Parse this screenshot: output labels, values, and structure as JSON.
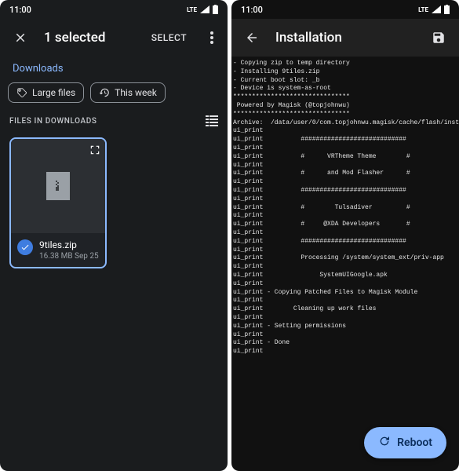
{
  "status": {
    "time": "11:00",
    "network": "LTE"
  },
  "left": {
    "title": "1 selected",
    "select": "SELECT",
    "breadcrumb": "Downloads",
    "chips": {
      "large_files": "Large files",
      "this_week": "This week"
    },
    "section_label": "FILES IN DOWNLOADS",
    "file": {
      "name": "9tiles.zip",
      "meta": "16.38 MB Sep 25"
    }
  },
  "right": {
    "title": "Installation",
    "terminal_lines": [
      "- Copying zip to temp directory",
      "- Installing 9tiles.zip",
      "- Current boot slot: _b",
      "- Device is system-as-root",
      "*******************************",
      " Powered by Magisk (@topjohnwu)",
      "*******************************",
      "Archive:  /data/user/0/com.topjohnwu.magisk/cache/flash/inst",
      "ui_print",
      "ui_print          ############################",
      "ui_print",
      "ui_print          #      VRTheme Theme        #",
      "ui_print",
      "ui_print          #      and Mod Flasher      #",
      "ui_print",
      "ui_print          ############################",
      "ui_print",
      "ui_print          #        Tulsadiver         #",
      "ui_print",
      "ui_print          #     @XDA Developers       #",
      "ui_print",
      "ui_print          ############################",
      "ui_print",
      "ui_print          Processing /system/system_ext/priv-app",
      "ui_print",
      "ui_print               SystemUIGoogle.apk",
      "ui_print",
      "ui_print - Copying Patched Files to Magisk Module",
      "ui_print",
      "ui_print        Cleaning up work files",
      "ui_print",
      "ui_print - Setting permissions",
      "ui_print",
      "ui_print - Done",
      "ui_print"
    ],
    "reboot": "Reboot"
  }
}
